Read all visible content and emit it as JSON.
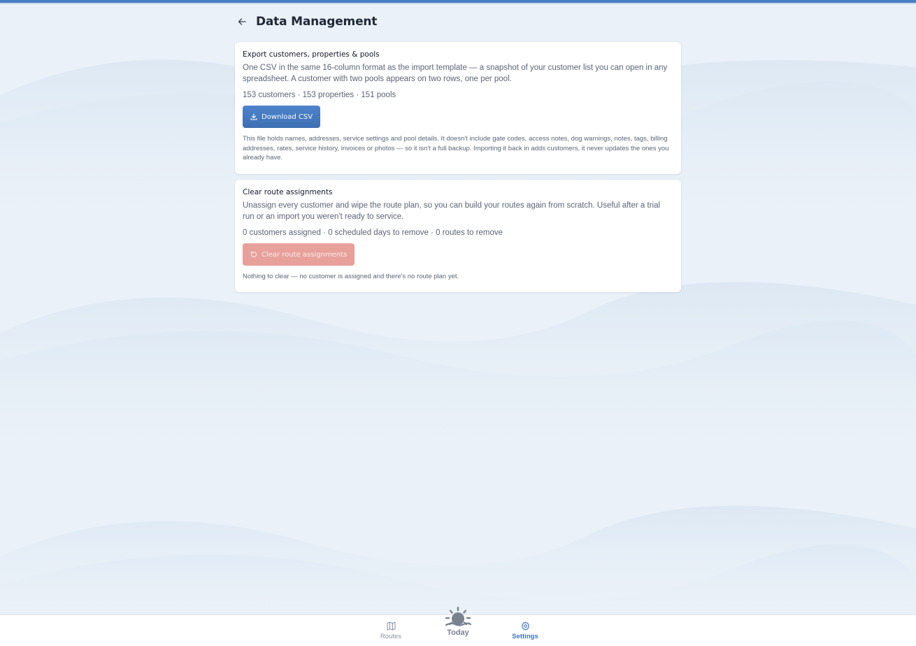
{
  "header": {
    "title": "Data Management"
  },
  "export_card": {
    "title": "Export customers, properties & pools",
    "description": "One CSV in the same 16-column format as the import template — a snapshot of your customer list you can open in any spreadsheet. A customer with two pools appears on two rows, one per pool.",
    "stats": "153 customers · 153 properties · 151 pools",
    "button_label": "Download CSV",
    "note": "This file holds names, addresses, service settings and pool details. It doesn't include gate codes, access notes, dog warnings, notes, tags, billing addresses, rates, service history, invoices or photos — so it isn't a full backup. Importing it back in adds customers, it never updates the ones you already have."
  },
  "clear_card": {
    "title": "Clear route assignments",
    "description": "Unassign every customer and wipe the route plan, so you can build your routes again from scratch. Useful after a trial run or an import you weren't ready to service.",
    "stats": "0 customers assigned · 0 scheduled days to remove · 0 routes to remove",
    "button_label": "Clear route assignments",
    "note": "Nothing to clear — no customer is assigned and there's no route plan yet."
  },
  "bottom_nav": {
    "routes_label": "Routes",
    "today_label": "Today",
    "settings_label": "Settings",
    "active": "Settings"
  },
  "colors": {
    "accent": "#3f74be",
    "primary_button": "#4a7fc7",
    "danger_disabled": "#e8a09a",
    "background": "#eaf1f8"
  },
  "icons": {
    "back": "arrow-left-icon",
    "download": "download-icon",
    "clear": "rotate-ccw-icon",
    "routes": "map-icon",
    "today": "sun-icon",
    "settings": "gear-icon"
  }
}
